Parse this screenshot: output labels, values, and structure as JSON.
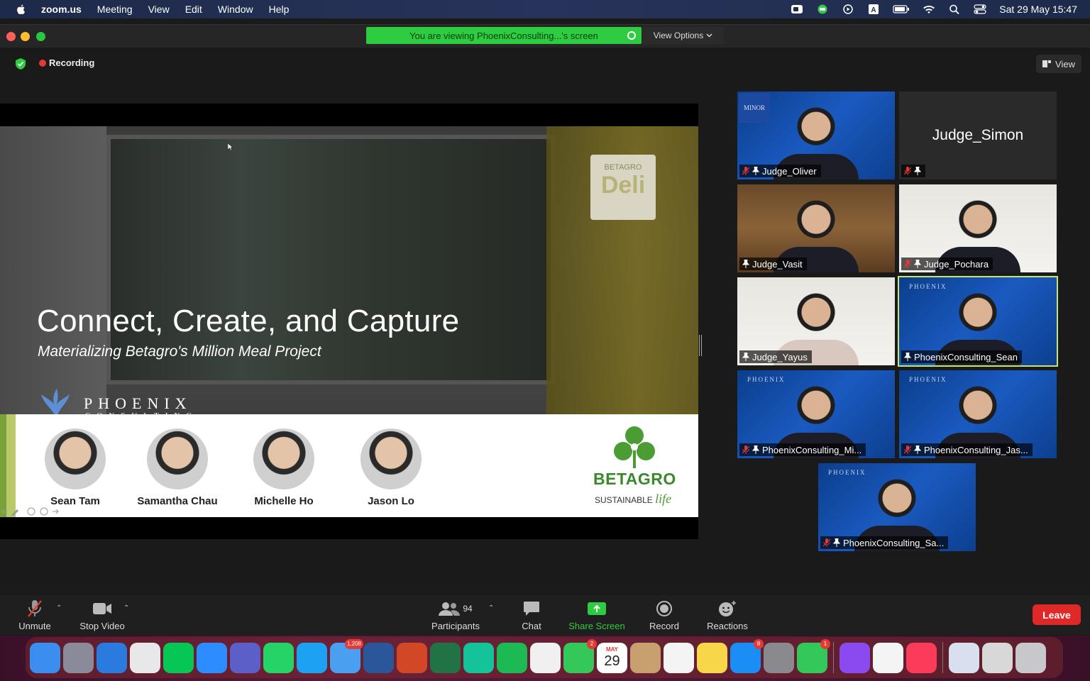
{
  "menubar": {
    "app_name": "zoom.us",
    "items": [
      "Meeting",
      "View",
      "Edit",
      "Window",
      "Help"
    ],
    "clock": "Sat 29 May  15:47"
  },
  "window": {
    "share_banner": "You are viewing PhoenixConsulting...'s screen",
    "view_options": "View Options",
    "recording": "Recording",
    "view_button": "View"
  },
  "slide": {
    "sign_brand": "BETAGRO",
    "sign_word": "Deli",
    "title": "Connect, Create, and Capture",
    "subtitle": "Materializing Betagro's Million Meal Project",
    "company_name": "PHOENIX",
    "company_sub": "CONSULTING",
    "team": [
      {
        "name": "Sean Tam"
      },
      {
        "name": "Samantha Chau"
      },
      {
        "name": "Michelle Ho"
      },
      {
        "name": "Jason Lo"
      }
    ],
    "brand": "BETAGRO",
    "brand_tag": "SUSTAINABLE",
    "brand_tag_script": "life"
  },
  "gallery": [
    {
      "name": "Judge_Oliver",
      "muted": true,
      "bg": "blue",
      "mark": "MINOR"
    },
    {
      "name": "Judge_Simon",
      "muted": true,
      "bg": "dark",
      "video": false
    },
    {
      "name": "Judge_Vasit",
      "muted": false,
      "bg": "wood"
    },
    {
      "name": "Judge_Pochara",
      "muted": true,
      "bg": "white"
    },
    {
      "name": "Judge_Yayus",
      "muted": false,
      "bg": "white"
    },
    {
      "name": "PhoenixConsulting_Sean",
      "muted": false,
      "bg": "blue",
      "active": true,
      "mark": "PHOENIX"
    },
    {
      "name": "PhoenixConsulting_Mi...",
      "muted": true,
      "bg": "blue",
      "mark": "PHOENIX"
    },
    {
      "name": "PhoenixConsulting_Jas...",
      "muted": true,
      "bg": "blue",
      "mark": "PHOENIX"
    },
    {
      "name": "PhoenixConsulting_Sa...",
      "muted": true,
      "bg": "blue",
      "mark": "PHOENIX"
    }
  ],
  "toolbar": {
    "unmute": "Unmute",
    "stop_video": "Stop Video",
    "participants": "Participants",
    "participants_count": "94",
    "chat": "Chat",
    "share_screen": "Share Screen",
    "record": "Record",
    "reactions": "Reactions",
    "leave": "Leave"
  },
  "dock": [
    {
      "name": "finder-icon",
      "color": "#3a8ef0"
    },
    {
      "name": "launchpad-icon",
      "color": "#8a8a9a"
    },
    {
      "name": "safari-icon",
      "color": "#2a7ae0"
    },
    {
      "name": "chrome-icon",
      "color": "#e8e8e8"
    },
    {
      "name": "line-icon",
      "color": "#06c755"
    },
    {
      "name": "zoom-icon",
      "color": "#2d8cff"
    },
    {
      "name": "teams-icon",
      "color": "#5b5fc7"
    },
    {
      "name": "whatsapp-icon",
      "color": "#25d366"
    },
    {
      "name": "twitter-icon",
      "color": "#1da1f2"
    },
    {
      "name": "mail-icon",
      "color": "#4aa0f0",
      "badge": "1,208"
    },
    {
      "name": "word-icon",
      "color": "#2b579a"
    },
    {
      "name": "powerpoint-icon",
      "color": "#d24726"
    },
    {
      "name": "excel-icon",
      "color": "#217346"
    },
    {
      "name": "grammarly-icon",
      "color": "#15c39a"
    },
    {
      "name": "spotify-icon",
      "color": "#1db954"
    },
    {
      "name": "photos-icon",
      "color": "#f0f0f0"
    },
    {
      "name": "facetime-icon",
      "color": "#34c759",
      "badge": "2"
    },
    {
      "name": "calendar-icon",
      "color": "#ffffff",
      "month": "MAY",
      "day": "29"
    },
    {
      "name": "contacts-icon",
      "color": "#c8a070"
    },
    {
      "name": "reminders-icon",
      "color": "#f4f4f4"
    },
    {
      "name": "notes-icon",
      "color": "#f8d64a"
    },
    {
      "name": "appstore-icon",
      "color": "#1a8ef5",
      "badge": "8"
    },
    {
      "name": "settings-icon",
      "color": "#8a8a8e"
    },
    {
      "name": "messages-icon",
      "color": "#34c759",
      "badge": "1"
    },
    {
      "name": "siri-icon",
      "color": "#8a4af0"
    },
    {
      "name": "textedit-icon",
      "color": "#f4f4f4"
    },
    {
      "name": "music-icon",
      "color": "#fa3c5a"
    },
    {
      "name": "preview-icon",
      "color": "#d8e0f0"
    },
    {
      "name": "downloads-icon",
      "color": "#d8d8d8"
    },
    {
      "name": "trash-icon",
      "color": "#c8c8cc"
    }
  ]
}
